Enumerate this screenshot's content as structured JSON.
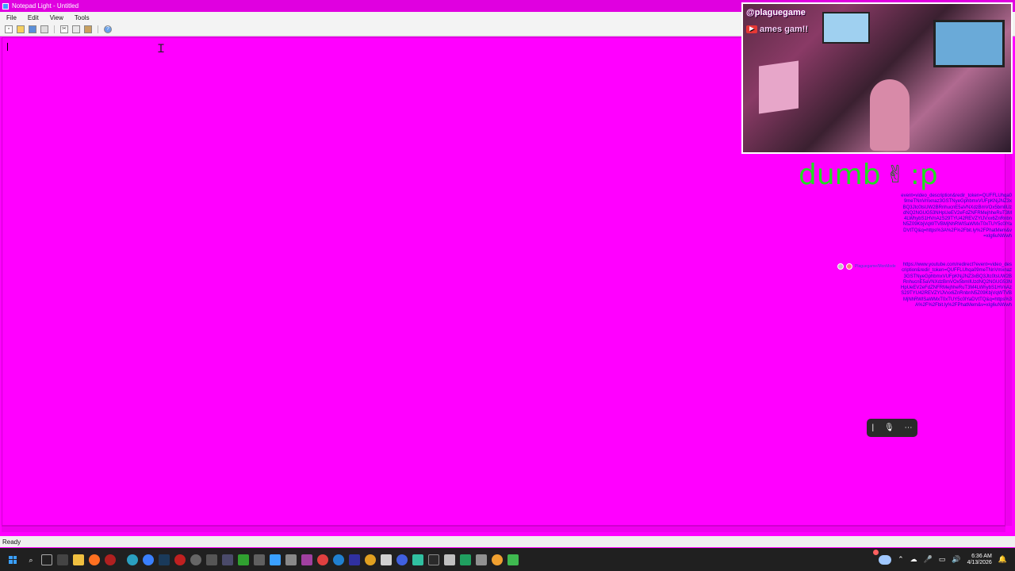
{
  "window": {
    "title": "Notepad Light - Untitled"
  },
  "menu": [
    "File",
    "Edit",
    "View",
    "Tools"
  ],
  "toolbar": {
    "buttons": [
      {
        "icon": "new-file-icon"
      },
      {
        "icon": "open-folder-icon"
      },
      {
        "icon": "save-icon"
      },
      {
        "icon": "print-icon"
      },
      {
        "icon": "cut-icon"
      },
      {
        "icon": "copy-icon"
      },
      {
        "icon": "paste-icon"
      },
      {
        "icon": "help-icon"
      }
    ]
  },
  "status": {
    "text": "Ready"
  },
  "colors": {
    "background": "#ff00ff",
    "overlay_text": "#22dd22",
    "links": "#1010c0"
  },
  "webcam": {
    "handle": "@plaguegame",
    "channel": "ames gam!!"
  },
  "overlay": {
    "text": "dumb",
    "suffix": ":p",
    "emoji": "✌"
  },
  "urls": {
    "block1": "event=video_description&redir_token=QUFFLUhqa09meTNnVmxnaz3GSTNyeGphbmxVUFpKNjJNZ3xBQ3Jtc0tsUW2BRnhucnE5aVNXdzBmVOx5bmllUzdNQ2NGUG53NHpUeEV2eFdZNFRMejhheRuT3M4LWhybS1HVnAzS29TYU42REVZYlJVxx6ZnRnbnN5Z09KbjVqWTVBMjNhRWlSaWMxT0xTUY5c0lYaDVtTQ&q=https%3A%2F%2Fbit.ly%2FPhatMem&v=xIg6uNWwh",
    "block2": "https://www.youtube.com/redirect?event=video_description&redir_token=QUFFLUhqa09meTNnVmxnaz3GSTNyeGphbmxVUFpKNjJNZ3xBQ3Jtc0tsUW2BRnhucnE5aVNXdzBmVOx5bmllUzdNQ2NGUG53NHpUeEV2eFdZNFRMejhheRuT3M4LWhybS1HVnAzS29TYU42REVZYlJVxx6ZnRnbnN5Z09KbjVqWTVBMjNhRWlSaWMxT0xTUY5c0lYaDVtTQ&q=https%3A%2F%2Fbit.ly%2FPhatMem&v=xIg6uNWwh"
  },
  "mini_widget": {
    "label": "Plaguegame/MonMode"
  },
  "dictation": {
    "buttons": [
      {
        "icon": "cursor-icon"
      },
      {
        "icon": "microphone-icon"
      },
      {
        "icon": "more-icon"
      }
    ]
  },
  "taskbar": {
    "icons": [
      "search-icon",
      "task-view-icon",
      "file-explorer-icon",
      "folder-icon",
      "firefox-icon",
      "record-icon",
      "steam-icon",
      "edge-icon",
      "chrome-icon",
      "media-icon",
      "settings-icon",
      "app-icon"
    ],
    "clock": {
      "time": "6:36 AM",
      "date": "4/13/2026"
    }
  }
}
